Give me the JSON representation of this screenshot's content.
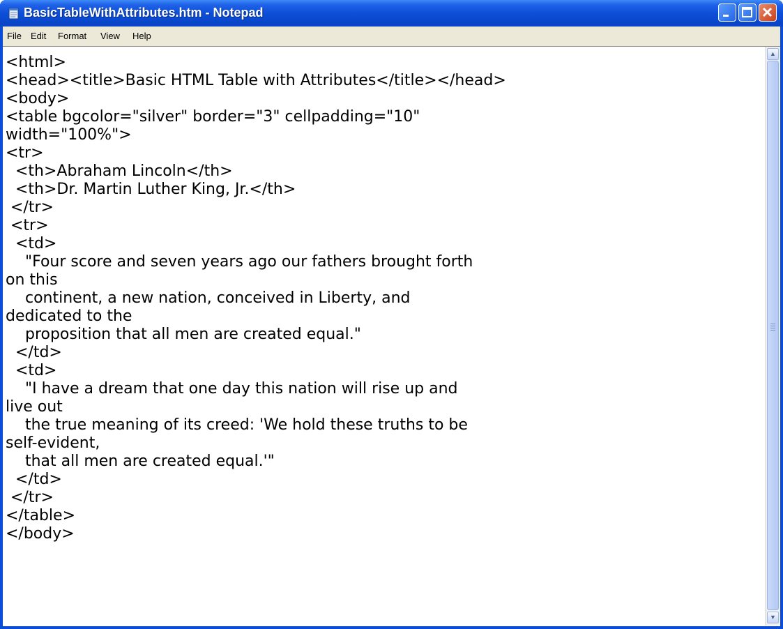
{
  "window": {
    "title": "BasicTableWithAttributes.htm - Notepad"
  },
  "menu": [
    "File",
    "Edit",
    "Format",
    "View",
    "Help"
  ],
  "editor": {
    "lines": [
      "<html>",
      "<head><title>Basic HTML Table with Attributes</title></head>",
      "<body>",
      "<table bgcolor=\"silver\" border=\"3\" cellpadding=\"10\"",
      "width=\"100%\">",
      "<tr>",
      "  <th>Abraham Lincoln</th>",
      "  <th>Dr. Martin Luther King, Jr.</th>",
      " </tr>",
      " <tr>",
      "  <td>",
      "    \"Four score and seven years ago our fathers brought forth",
      "on this",
      "    continent, a new nation, conceived in Liberty, and",
      "dedicated to the",
      "    proposition that all men are created equal.\"",
      "  </td>",
      "  <td>",
      "    \"I have a dream that one day this nation will rise up and",
      "live out",
      "    the true meaning of its creed: 'We hold these truths to be",
      "self-evident,",
      "    that all men are created equal.'\"",
      "  </td>",
      " </tr>",
      "</table>",
      "</body>"
    ]
  },
  "icons": {
    "app": "notepad-icon",
    "minimize": "minimize-icon",
    "maximize": "maximize-icon",
    "close": "close-icon",
    "scroll_up": "arrow-up-icon",
    "scroll_down": "arrow-down-icon"
  },
  "colors": {
    "titlebar": "#0a47cc",
    "close_button": "#c8411a",
    "menubar": "#ece9d8"
  }
}
